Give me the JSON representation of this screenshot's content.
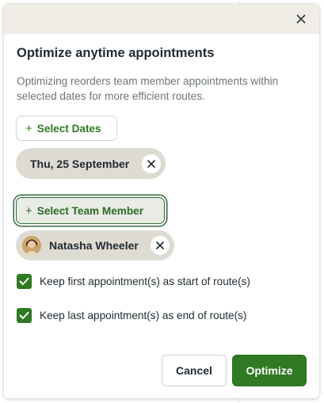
{
  "dialog": {
    "title": "Optimize anytime appointments",
    "description": "Optimizing reorders team member appointments within selected dates for more efficient routes.",
    "close_icon": "close-icon"
  },
  "dates": {
    "button_label": "Select Dates",
    "selected": "Thu, 25 September"
  },
  "team": {
    "button_label": "Select Team Member",
    "selected": "Natasha Wheeler"
  },
  "options": {
    "keep_first": {
      "label": "Keep first appointment(s) as start of route(s)",
      "checked": true
    },
    "keep_last": {
      "label": "Keep last appointment(s) as end of route(s)",
      "checked": true
    }
  },
  "footer": {
    "cancel_label": "Cancel",
    "optimize_label": "Optimize"
  },
  "colors": {
    "accent": "#2f7a23",
    "header_bg": "#efede6",
    "chip_bg": "#dedbd3"
  }
}
